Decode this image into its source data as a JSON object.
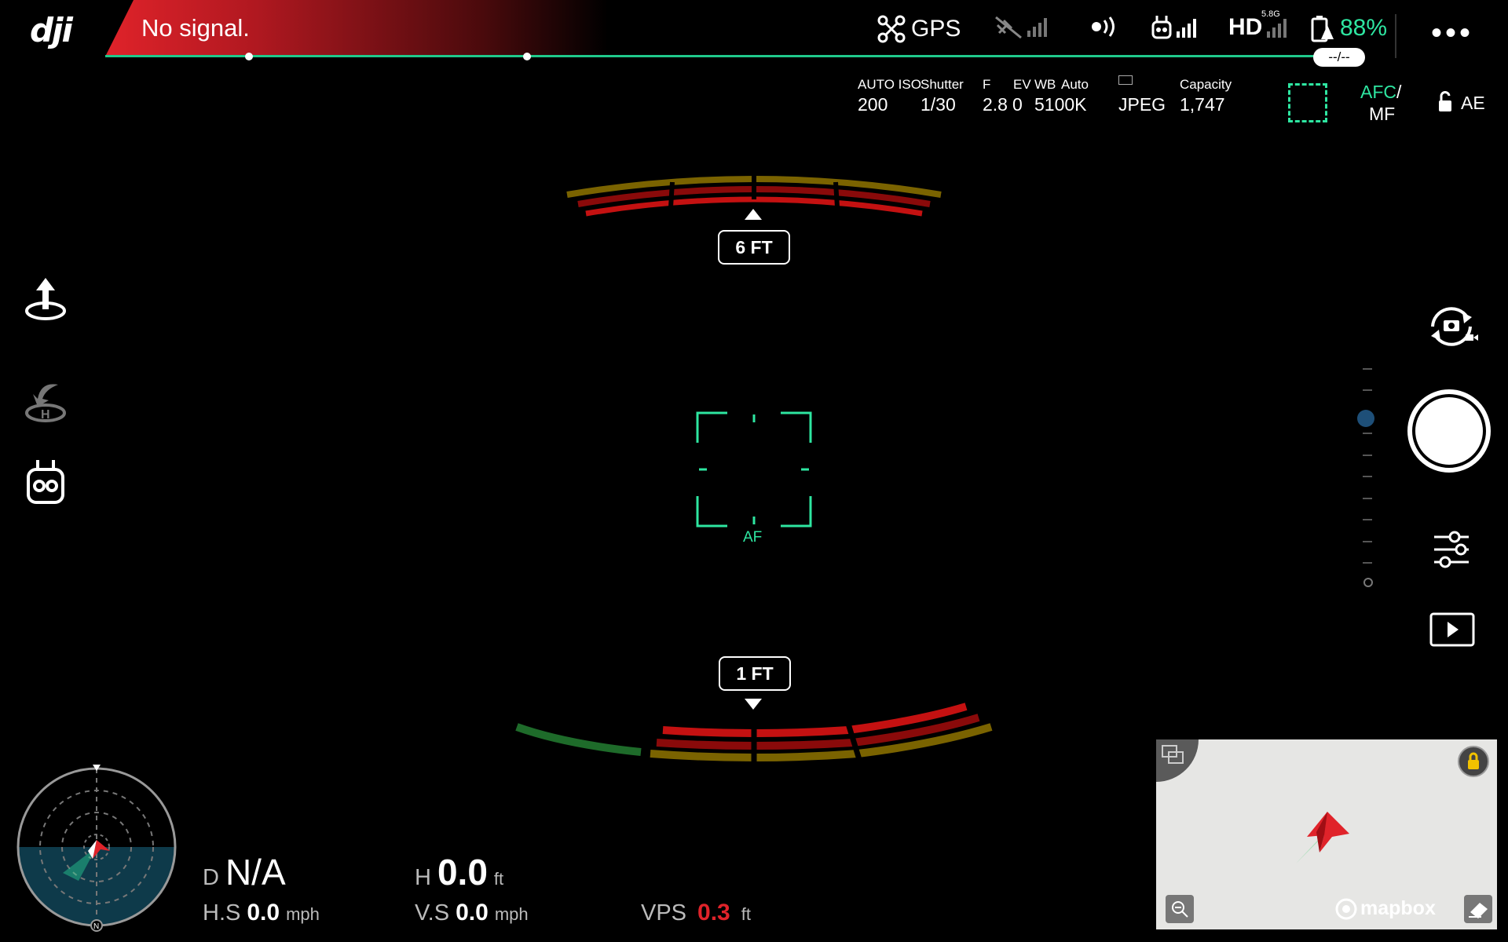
{
  "app": {
    "logo_text": "dji"
  },
  "status_bar": {
    "signal_message": "No signal.",
    "gps_label": "GPS",
    "hd_label": "HD",
    "hd_band": "5.8G",
    "battery_percent": "88%",
    "time_pill": "--/--",
    "more_label": "•••"
  },
  "camera_params": {
    "iso_label": "AUTO ISO",
    "iso_value": "200",
    "shutter_label": "Shutter",
    "shutter_value": "1/30",
    "f_label": "F",
    "f_value": "2.8",
    "ev_label": "EV",
    "ev_value": "0",
    "wb_label": "WB",
    "wb_mode": "Auto",
    "wb_value": "5100K",
    "format_value": "JPEG",
    "capacity_label": "Capacity",
    "capacity_value": "1,747",
    "afc_label": "AFC",
    "slash": "/",
    "mf_label": "MF",
    "ae_label": "AE"
  },
  "obstacle": {
    "front_distance": "6 FT",
    "rear_distance": "1 FT"
  },
  "focus": {
    "af_label": "AF"
  },
  "telemetry": {
    "d_label": "D",
    "d_value": "N/A",
    "h_label": "H",
    "h_value": "0.0",
    "h_unit": "ft",
    "hs_label": "H.S",
    "hs_value": "0.0",
    "hs_unit": "mph",
    "vs_label": "V.S",
    "vs_value": "0.0",
    "vs_unit": "mph",
    "vps_label": "VPS",
    "vps_value": "0.3",
    "vps_unit": "ft"
  },
  "map": {
    "attribution": "mapbox",
    "compass_north": "N"
  },
  "colors": {
    "accent_green": "#2ee6a1",
    "warning_red": "#e0232a",
    "vps_red": "#e0232a",
    "map_bg": "#e6e6e4"
  }
}
